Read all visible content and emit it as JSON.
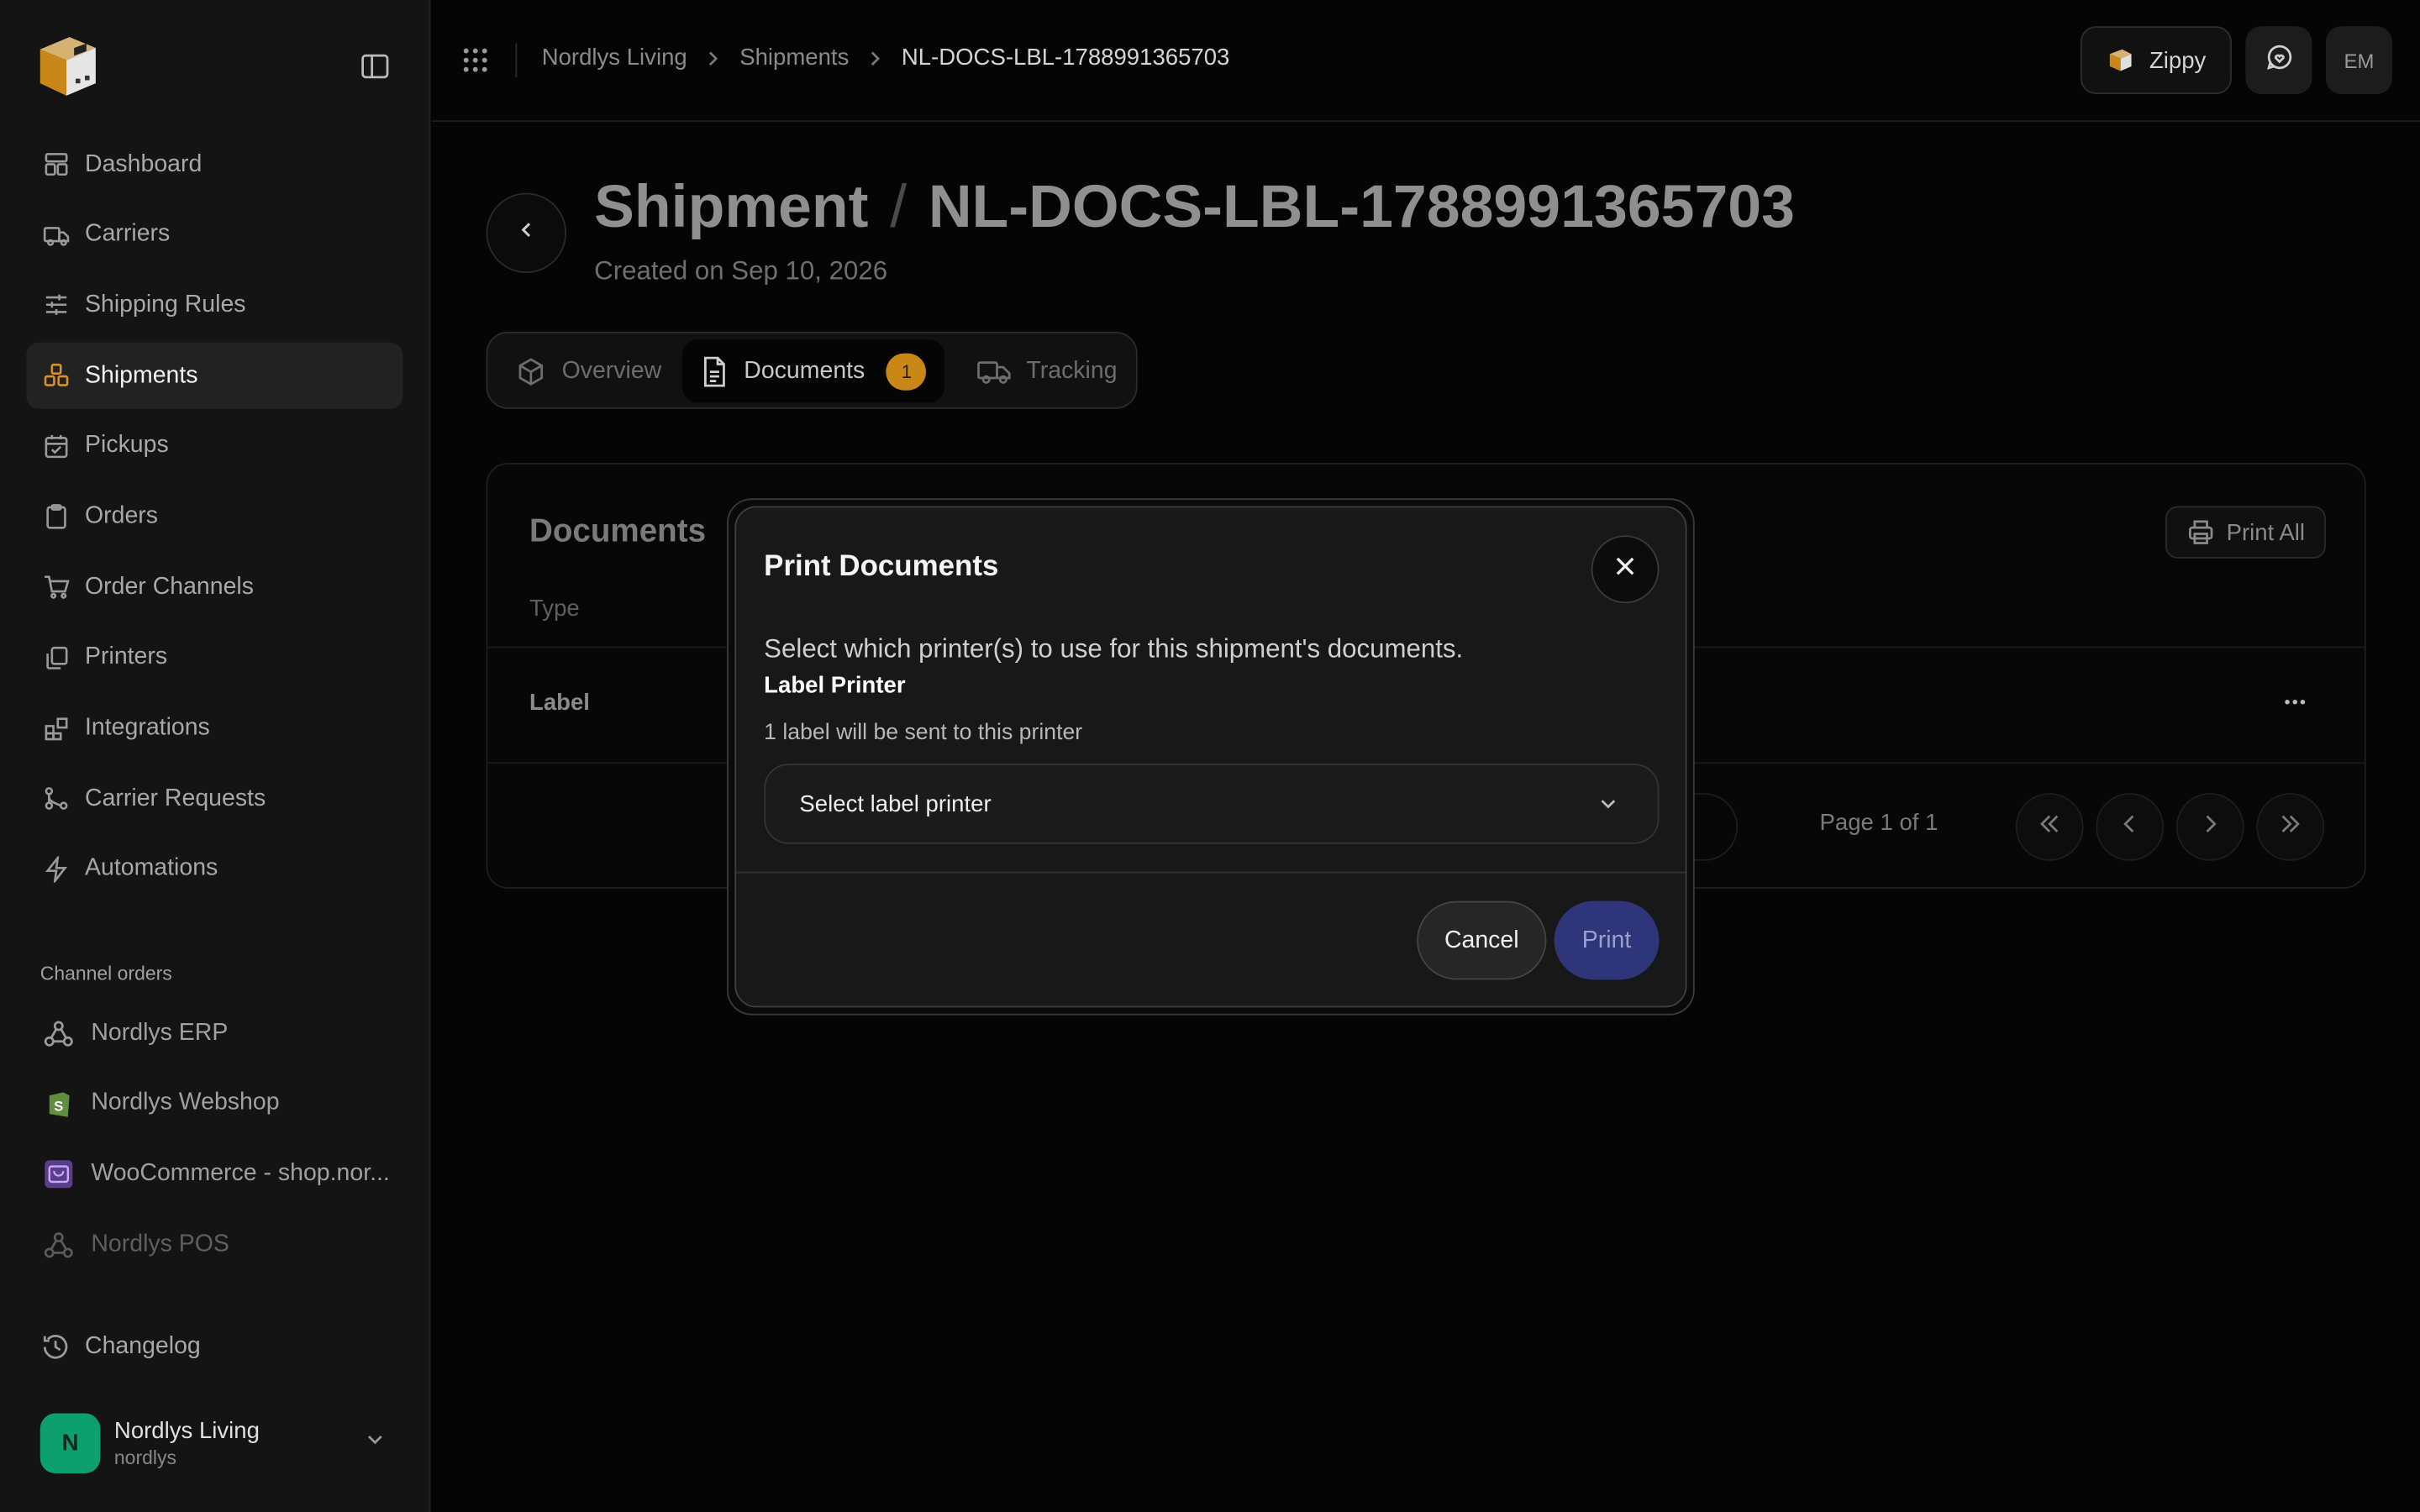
{
  "colors": {
    "accent": "#c88716",
    "primary_button": "#2e3578",
    "avatar_bg": "#0e9f6e",
    "background": "#050505",
    "sidebar_bg": "#141414"
  },
  "sidebar": {
    "logo_icon": "box-logo-icon",
    "items": [
      {
        "label": "Dashboard",
        "icon": "dashboard-icon"
      },
      {
        "label": "Carriers",
        "icon": "truck-icon"
      },
      {
        "label": "Shipping Rules",
        "icon": "sliders-icon"
      },
      {
        "label": "Shipments",
        "icon": "boxes-icon",
        "active": true
      },
      {
        "label": "Pickups",
        "icon": "calendar-check-icon"
      },
      {
        "label": "Orders",
        "icon": "clipboard-icon"
      },
      {
        "label": "Order Channels",
        "icon": "cart-icon"
      },
      {
        "label": "Printers",
        "icon": "copy-icon"
      },
      {
        "label": "Integrations",
        "icon": "blocks-icon"
      },
      {
        "label": "Carrier Requests",
        "icon": "git-branch-icon"
      },
      {
        "label": "Automations",
        "icon": "zap-icon"
      }
    ],
    "channel_section_label": "Channel orders",
    "channels": [
      {
        "label": "Nordlys ERP",
        "icon": "webhook-icon"
      },
      {
        "label": "Nordlys Webshop",
        "icon": "shopify-icon"
      },
      {
        "label": "WooCommerce - shop.nor...",
        "icon": "woocommerce-icon"
      },
      {
        "label": "Nordlys POS",
        "icon": "webhook-icon",
        "muted": true
      }
    ],
    "changelog_label": "Changelog",
    "account": {
      "initial": "N",
      "name": "Nordlys Living",
      "handle": "nordlys"
    }
  },
  "topbar": {
    "breadcrumbs": [
      "Nordlys Living",
      "Shipments",
      "NL-DOCS-LBL-1788991365703"
    ],
    "zippy_label": "Zippy",
    "user_initials": "EM"
  },
  "page": {
    "title": "Shipment",
    "shipment_id": "NL-DOCS-LBL-1788991365703",
    "created": "Created on Sep 10, 2026",
    "tabs": [
      {
        "label": "Overview",
        "icon": "package-icon"
      },
      {
        "label": "Documents",
        "icon": "file-text-icon",
        "badge": "1",
        "active": true
      },
      {
        "label": "Tracking",
        "icon": "truck-icon"
      }
    ]
  },
  "documents": {
    "title": "Documents",
    "print_all_label": "Print All",
    "columns": [
      "Type"
    ],
    "rows": [
      {
        "type": "Label"
      }
    ],
    "pagination": {
      "text": "Page 1 of 1"
    }
  },
  "modal": {
    "title": "Print Documents",
    "description": "Select which printer(s) to use for this shipment's documents.",
    "field_label": "Label Printer",
    "hint": "1 label will be sent to this printer",
    "select_placeholder": "Select label printer",
    "cancel_label": "Cancel",
    "print_label": "Print"
  }
}
